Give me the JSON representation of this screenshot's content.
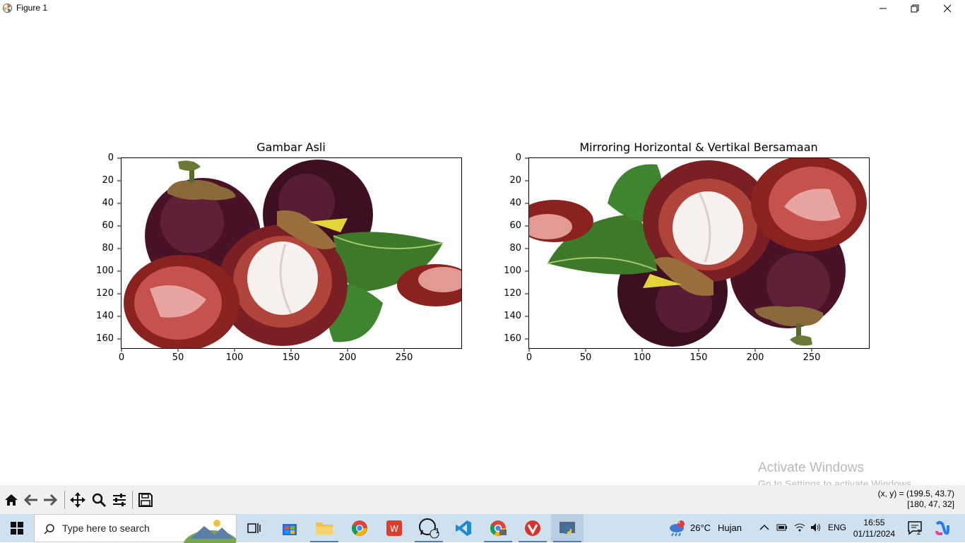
{
  "window": {
    "title": "Figure 1"
  },
  "figure": {
    "axes": [
      {
        "title": "Gambar Asli",
        "image_description": "mangosteen fruits with leaves, original orientation",
        "yticks": [
          "0",
          "20",
          "40",
          "60",
          "80",
          "100",
          "120",
          "140",
          "160"
        ],
        "xticks": [
          "0",
          "50",
          "100",
          "150",
          "200",
          "250"
        ]
      },
      {
        "title": "Mirroring Horizontal & Vertikal Bersamaan",
        "image_description": "same mangosteen image flipped horizontally and vertically",
        "yticks": [
          "0",
          "20",
          "40",
          "60",
          "80",
          "100",
          "120",
          "140",
          "160"
        ],
        "xticks": [
          "0",
          "50",
          "100",
          "150",
          "200",
          "250"
        ]
      }
    ]
  },
  "watermark": {
    "line1": "Activate Windows",
    "line2": "Go to Settings to activate Windows."
  },
  "toolbar": {
    "buttons": [
      "home-icon",
      "back-icon",
      "forward-icon",
      "pan-icon",
      "zoom-icon",
      "configure-icon",
      "save-icon"
    ],
    "coord_line1": "(x, y) = (199.5, 43.7)",
    "coord_line2": "[180, 47, 32]"
  },
  "taskbar": {
    "search_placeholder": "Type here to search",
    "weather_temp": "26°C",
    "weather_text": "Hujan",
    "weather_badge": "1",
    "language": "ENG",
    "time": "16:55",
    "date": "01/11/2024",
    "notification_count": "2",
    "whatsapp_badge": "1"
  }
}
